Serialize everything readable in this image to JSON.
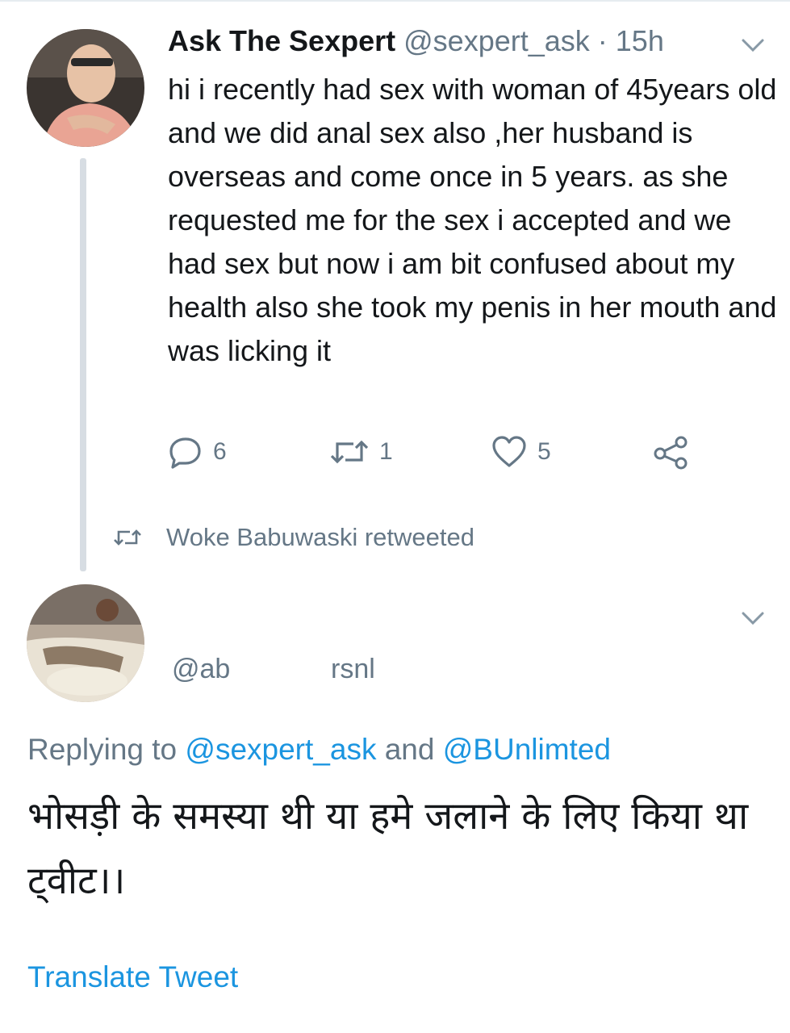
{
  "tweet1": {
    "display_name": "Ask The Sexpert",
    "handle": "@sexpert_ask",
    "time": " · 15h",
    "text": "hi i recently had sex with woman of 45years old and we did anal sex also ,her husband is overseas and come once in 5 years. as she requested me for the sex i accepted and we had sex but now i am bit confused about my health also she took my penis in her mouth and was licking it",
    "replies": "6",
    "retweets": "1",
    "likes": "5",
    "icons": {
      "reply": "reply-icon",
      "retweet": "retweet-icon",
      "like": "heart-icon",
      "share": "share-icon",
      "menu": "chevron-down-icon"
    }
  },
  "retweet_banner": {
    "text": "Woke Babuwaski retweeted",
    "icon": "retweet-icon"
  },
  "tweet2": {
    "handle_left": "@ab",
    "handle_right": "rsnl",
    "replying_prefix": "Replying to ",
    "replying_user1": "@sexpert_ask",
    "replying_and": " and ",
    "replying_user2": "@BUnlimted",
    "text": "भोसड़ी के समस्या थी या हमे जलाने के लिए किया था ट्वीट।।",
    "translate": "Translate Tweet"
  },
  "colors": {
    "text": "#14171a",
    "secondary": "#657786",
    "link": "#1b95e0",
    "thread_line": "#d7dde3"
  }
}
